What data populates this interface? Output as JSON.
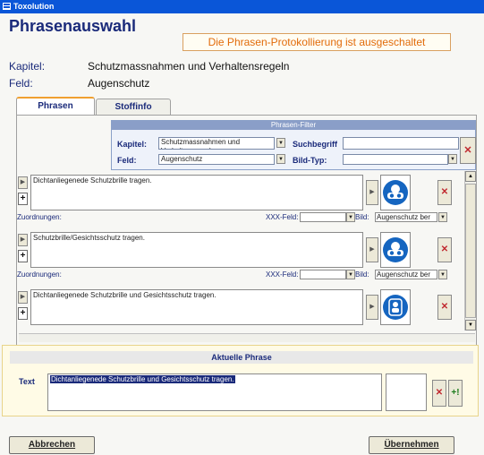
{
  "window": {
    "title": "Toxolution"
  },
  "page_title": "Phrasenauswahl",
  "banner": "Die Phrasen-Protokollierung ist ausgeschaltet",
  "info": {
    "kapitel_label": "Kapitel:",
    "kapitel_value": "Schutzmassnahmen und Verhaltensregeln",
    "feld_label": "Feld:",
    "feld_value": "Augenschutz"
  },
  "tabs": [
    {
      "label": "Phrasen",
      "active": true
    },
    {
      "label": "Stoffinfo",
      "active": false
    }
  ],
  "filter": {
    "header": "Phrasen-Filter",
    "kapitel_label": "Kapitel:",
    "kapitel_value": "Schutzmassnahmen und Verhaltensregeln",
    "feld_label": "Feld:",
    "feld_value": "Augenschutz",
    "suchbegriff_label": "Suchbegriff",
    "suchbegriff_value": "",
    "bildtyp_label": "Bild-Typ:",
    "bildtyp_value": ""
  },
  "phrases": [
    {
      "text": "Dichtanliegenede Schutzbrille tragen.",
      "zuordnungen_label": "Zuordnungen:",
      "xxx_label": "XXX-Feld:",
      "bild_label": "Bild:",
      "bild_value": "Augenschutz ber"
    },
    {
      "text": "Schutzbrille/Gesichtsschutz tragen.",
      "zuordnungen_label": "Zuordnungen:",
      "xxx_label": "XXX-Feld:",
      "bild_label": "Bild:",
      "bild_value": "Augenschutz ber"
    },
    {
      "text": "Dichtanliegenede Schutzbrille und Gesichtsschutz tragen.",
      "zuordnungen_label": "",
      "xxx_label": "",
      "bild_label": "",
      "bild_value": ""
    }
  ],
  "aktuelle": {
    "header": "Aktuelle Phrase",
    "text_label": "Text",
    "text_value": "Dichtanliegenede Schutzbrille und Gesichtsschutz tragen."
  },
  "buttons": {
    "cancel": "Abbrechen",
    "apply": "Übernehmen"
  },
  "icons": {
    "delete": "✕",
    "add": "+",
    "arrow": "▶",
    "dropdown": "▼",
    "up": "▲",
    "add_bang": "+!"
  },
  "colors": {
    "titlebar": "#0a56d8",
    "heading": "#1a2a7a",
    "banner_text": "#e26b0a",
    "delete_red": "#c0282e",
    "pictogram_blue": "#1565c0"
  }
}
